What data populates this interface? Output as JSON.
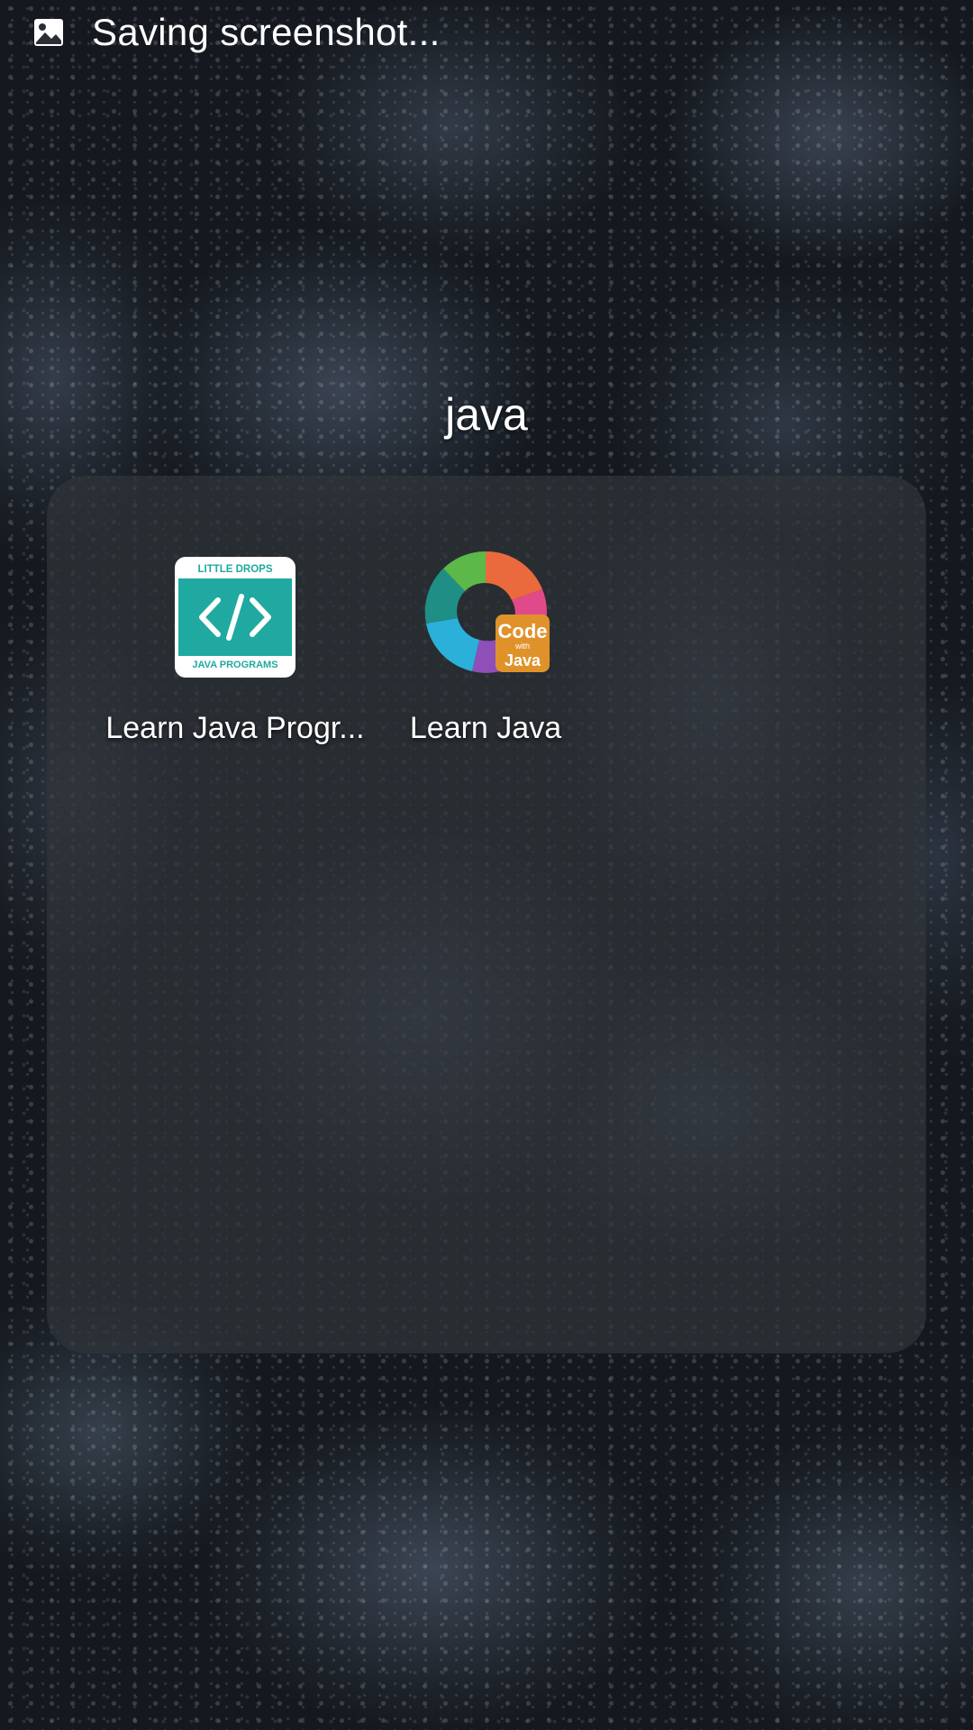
{
  "status_bar": {
    "notification_icon": "image-icon",
    "text": "Saving screenshot..."
  },
  "folder": {
    "title": "java",
    "apps": [
      {
        "label": "Learn Java Progr...",
        "icon": "little-drops-icon",
        "icon_text_top": "LITTLE DROPS",
        "icon_text_bottom": "JAVA PROGRAMS"
      },
      {
        "label": "Learn Java",
        "icon": "code-with-java-icon",
        "icon_text_main": "Code",
        "icon_text_small": "with",
        "icon_text_sub": "Java"
      }
    ]
  },
  "colors": {
    "little_drops_teal": "#1fa9a0",
    "code_badge_orange": "#e0922a",
    "folder_panel": "#30343a"
  }
}
